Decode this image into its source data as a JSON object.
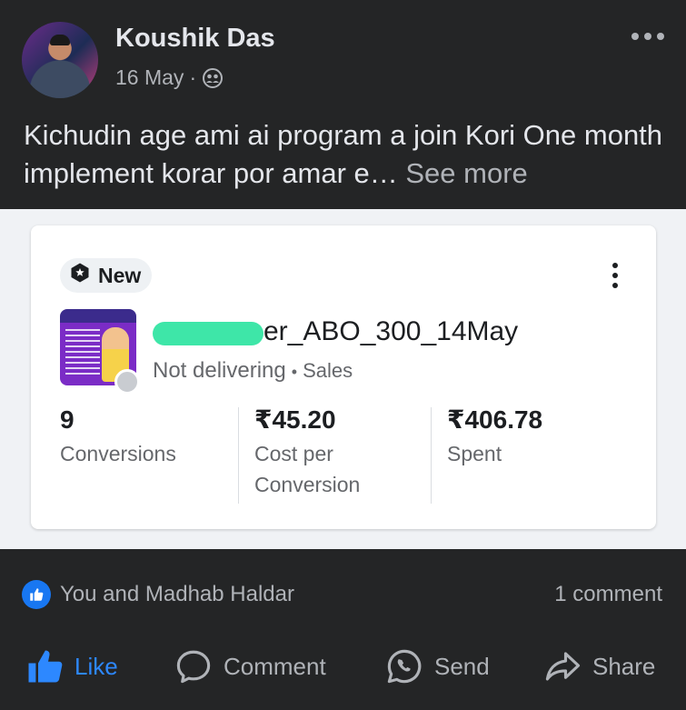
{
  "post": {
    "author": "Koushik Das",
    "date": "16 May",
    "separator": "·",
    "audience_icon": "friends-icon",
    "text": "Kichudin age ami ai program a join Kori One month implement korar por amar e…",
    "see_more": "See more"
  },
  "ad_card": {
    "badge": "New",
    "campaign_name": "er_ABO_300_14May",
    "status": "Not delivering",
    "status_separator": "•",
    "objective": "Sales",
    "metrics": [
      {
        "value": "9",
        "label": "Conversions"
      },
      {
        "value": "₹45.20",
        "label": "Cost per Conversion"
      },
      {
        "value": "₹406.78",
        "label": "Spent"
      }
    ]
  },
  "reactions": {
    "text": "You and Madhab Haldar",
    "comment_count": "1 comment"
  },
  "actions": {
    "like": "Like",
    "comment": "Comment",
    "send": "Send",
    "share": "Share"
  },
  "colors": {
    "background": "#242526",
    "accent": "#1877f2",
    "like_active": "#2d88ff",
    "redaction": "#3ee6a8"
  }
}
